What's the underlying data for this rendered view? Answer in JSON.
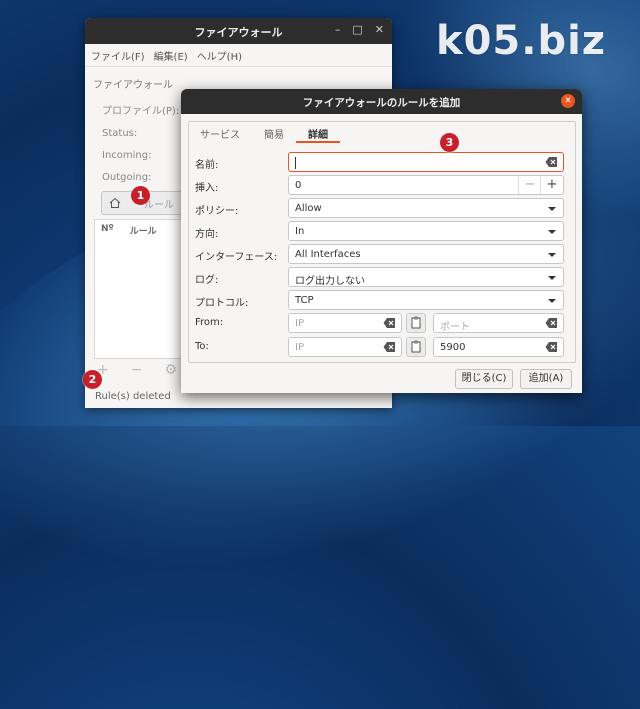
{
  "watermark": "k05.biz",
  "main_window": {
    "title": "ファイアウォール",
    "menu": [
      "ファイル(F)",
      "編集(E)",
      "ヘルプ(H)"
    ],
    "section_title": "ファイアウォール",
    "profile_label": "プロファイル(P):",
    "status_label": "Status:",
    "incoming_label": "Incoming:",
    "outgoing_label": "Outgoing:",
    "rules_tab_label": "ルール",
    "table_headers": [
      "Nº",
      "ルール"
    ],
    "status_text": "Rule(s) deleted"
  },
  "dialog": {
    "title": "ファイアウォールのルールを追加",
    "tabs": [
      "サービス",
      "簡易",
      "詳細"
    ],
    "active_tab": "詳細",
    "fields": {
      "name_label": "名前:",
      "name_value": "",
      "insert_label": "挿入:",
      "insert_value": "0",
      "policy_label": "ポリシー:",
      "policy_value": "Allow",
      "direction_label": "方向:",
      "direction_value": "In",
      "interface_label": "インターフェース:",
      "interface_value": "All Interfaces",
      "log_label": "ログ:",
      "log_value": "ログ出力しない",
      "protocol_label": "プロトコル:",
      "protocol_value": "TCP",
      "from_label": "From:",
      "from_ip_placeholder": "IP",
      "from_port_placeholder": "ポート",
      "to_label": "To:",
      "to_ip_placeholder": "IP",
      "to_port_value": "5900"
    },
    "close_button": "閉じる(C)",
    "add_button": "追加(A)"
  },
  "annotations": [
    "1",
    "2",
    "3"
  ],
  "colors": {
    "accent": "#e95420",
    "badge": "#c8202a",
    "titlebar": "#2d2d2d"
  }
}
